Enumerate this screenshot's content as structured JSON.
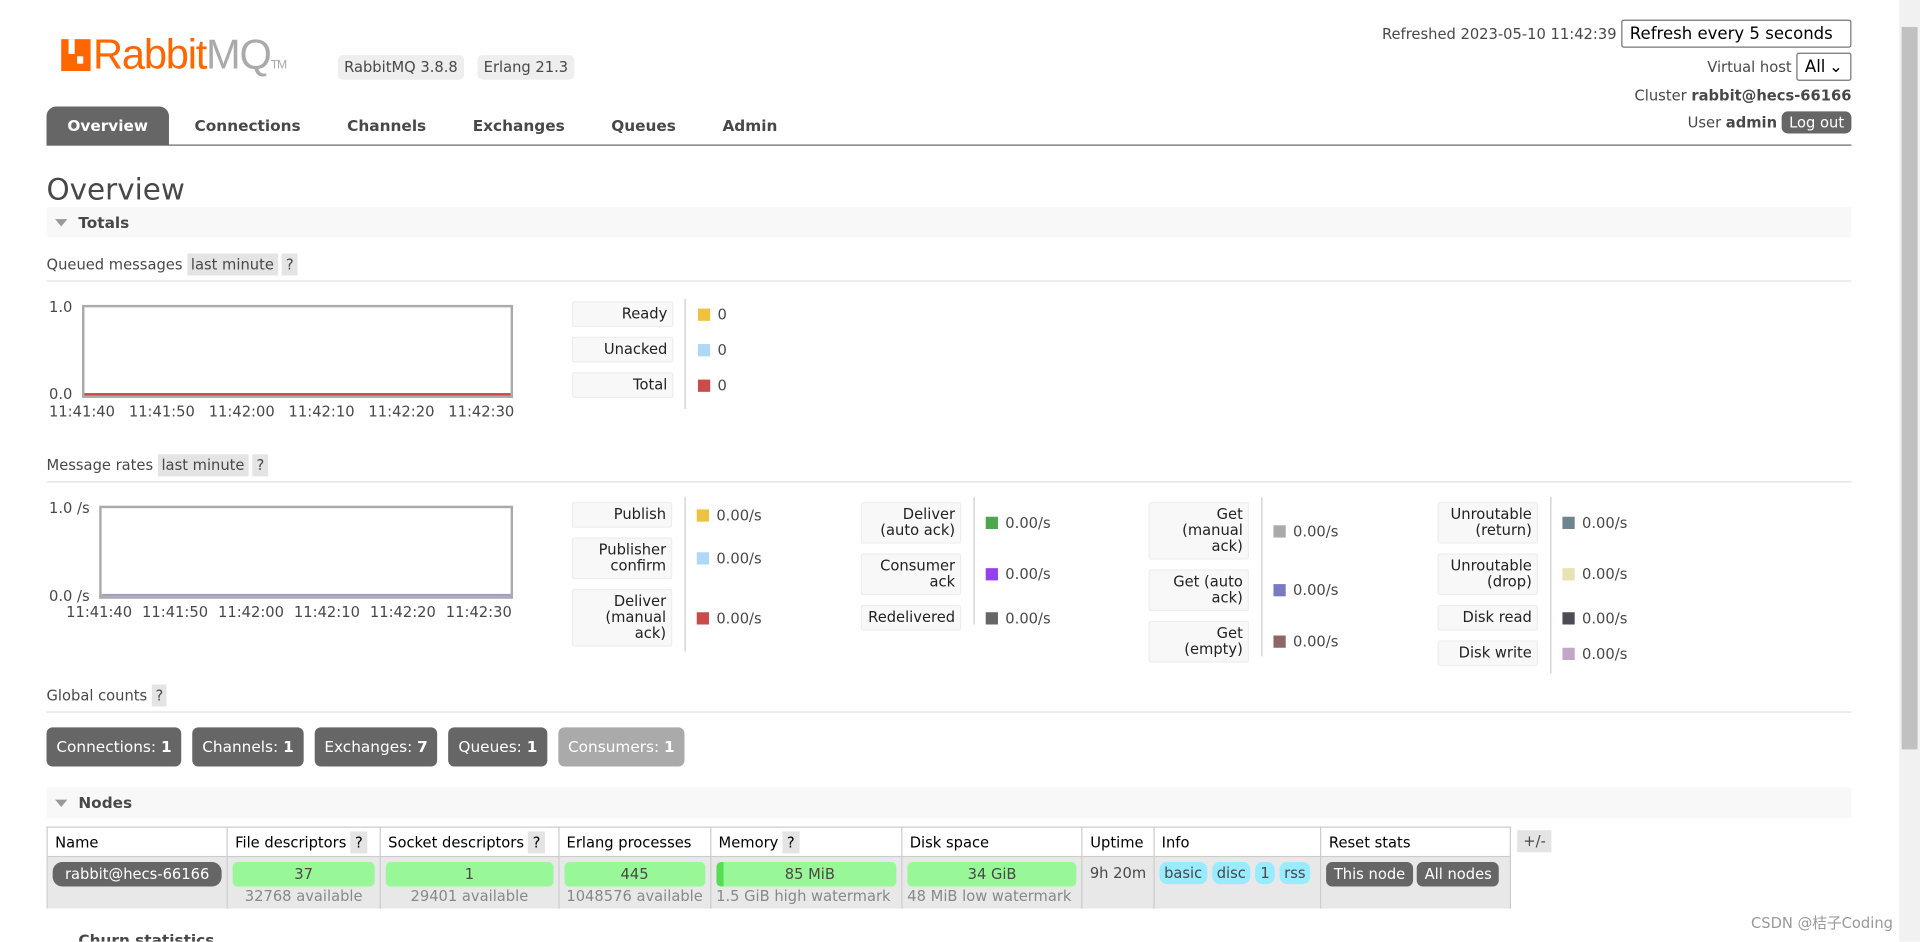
{
  "header": {
    "logo_text": "RabbitMQ",
    "logo_tm": "TM",
    "version": "RabbitMQ 3.8.8",
    "erlang": "Erlang 21.3",
    "refreshed": "Refreshed 2023-05-10 11:42:39",
    "refresh_select": "Refresh every 5 seconds",
    "vhost_label": "Virtual host",
    "vhost_select": "All",
    "cluster_label": "Cluster",
    "cluster": "rabbit@hecs-66166",
    "user_label": "User",
    "user": "admin",
    "logout": "Log out"
  },
  "nav": [
    "Overview",
    "Connections",
    "Channels",
    "Exchanges",
    "Queues",
    "Admin"
  ],
  "page_title": "Overview",
  "totals": {
    "title": "Totals",
    "queued": {
      "label": "Queued messages",
      "range": "last minute",
      "help": "?",
      "y_ticks": [
        "1.0",
        "0.0"
      ],
      "x_ticks": [
        "11:41:40",
        "11:41:50",
        "11:42:00",
        "11:42:10",
        "11:42:20",
        "11:42:30"
      ],
      "legend": [
        {
          "label": "Ready",
          "value": "0",
          "color": "#edc240"
        },
        {
          "label": "Unacked",
          "value": "0",
          "color": "#afd8f8"
        },
        {
          "label": "Total",
          "value": "0",
          "color": "#cb4b4b"
        }
      ]
    },
    "rates": {
      "label": "Message rates",
      "range": "last minute",
      "help": "?",
      "y_ticks": [
        "1.0 /s",
        "0.0 /s"
      ],
      "x_ticks": [
        "11:41:40",
        "11:41:50",
        "11:42:00",
        "11:42:10",
        "11:42:20",
        "11:42:30"
      ],
      "columns": [
        [
          {
            "label": "Publish",
            "value": "0.00/s",
            "color": "#edc240"
          },
          {
            "label": "Publisher confirm",
            "value": "0.00/s",
            "color": "#afd8f8"
          },
          {
            "label": "Deliver (manual ack)",
            "value": "0.00/s",
            "color": "#cb4b4b"
          }
        ],
        [
          {
            "label": "Deliver (auto ack)",
            "value": "0.00/s",
            "color": "#4da74d"
          },
          {
            "label": "Consumer ack",
            "value": "0.00/s",
            "color": "#9440ed"
          },
          {
            "label": "Redelivered",
            "value": "0.00/s",
            "color": "#666666"
          }
        ],
        [
          {
            "label": "Get (manual ack)",
            "value": "0.00/s",
            "color": "#aaaaaa"
          },
          {
            "label": "Get (auto ack)",
            "value": "0.00/s",
            "color": "#7c79c3"
          },
          {
            "label": "Get (empty)",
            "value": "0.00/s",
            "color": "#8d6666"
          }
        ],
        [
          {
            "label": "Unroutable (return)",
            "value": "0.00/s",
            "color": "#6d8590"
          },
          {
            "label": "Unroutable (drop)",
            "value": "0.00/s",
            "color": "#e6e4b0"
          },
          {
            "label": "Disk read",
            "value": "0.00/s",
            "color": "#4c4c54"
          },
          {
            "label": "Disk write",
            "value": "0.00/s",
            "color": "#c4a6c8"
          }
        ]
      ]
    },
    "global": {
      "label": "Global counts",
      "help": "?",
      "counts": [
        {
          "label": "Connections:",
          "value": "1"
        },
        {
          "label": "Channels:",
          "value": "1"
        },
        {
          "label": "Exchanges:",
          "value": "7"
        },
        {
          "label": "Queues:",
          "value": "1"
        },
        {
          "label": "Consumers:",
          "value": "1"
        }
      ]
    }
  },
  "nodes": {
    "title": "Nodes",
    "plus_minus": "+/-",
    "columns": [
      "Name",
      "File descriptors",
      "Socket descriptors",
      "Erlang processes",
      "Memory",
      "Disk space",
      "Uptime",
      "Info",
      "Reset stats"
    ],
    "row": {
      "name": "rabbit@hecs-66166",
      "fd": "37",
      "fd_sub": "32768 available",
      "sd": "1",
      "sd_sub": "29401 available",
      "ep": "445",
      "ep_sub": "1048576 available",
      "mem": "85 MiB",
      "mem_sub": "1.5 GiB high watermark",
      "disk": "34 GiB",
      "disk_sub": "48 MiB low watermark",
      "uptime": "9h 20m",
      "info": [
        "basic",
        "disc",
        "1",
        "rss"
      ],
      "reset": [
        "This node",
        "All nodes"
      ]
    }
  },
  "churn_title": "Churn statistics",
  "watermark": "CSDN @桔子Coding"
}
